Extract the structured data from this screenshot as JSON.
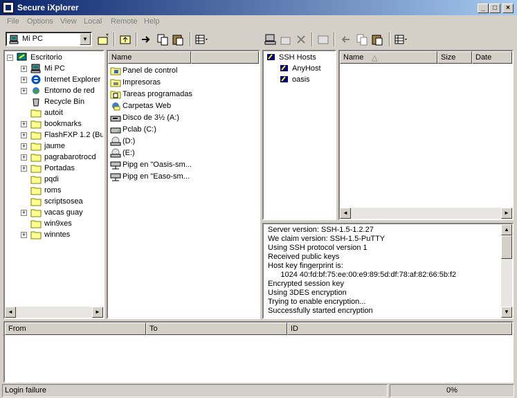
{
  "window": {
    "title": "Secure iXplorer",
    "controls": [
      "_",
      "□",
      "×"
    ]
  },
  "menu": [
    "File",
    "Options",
    "View",
    "Local",
    "Remote",
    "Help"
  ],
  "local": {
    "location": "Mi PC",
    "tree": [
      {
        "label": "Escritorio",
        "icon": "desktop-icon",
        "expander": "−"
      },
      {
        "label": "Mi PC",
        "icon": "computer-icon",
        "expander": "+"
      },
      {
        "label": "Internet Explorer",
        "icon": "ie-icon",
        "expander": "+"
      },
      {
        "label": "Entorno de red",
        "icon": "network-icon",
        "expander": "+"
      },
      {
        "label": "Recycle Bin",
        "icon": "recycle-bin-icon",
        "expander": ""
      },
      {
        "label": "autoit",
        "icon": "folder-icon",
        "expander": ""
      },
      {
        "label": "bookmarks",
        "icon": "folder-icon",
        "expander": "+"
      },
      {
        "label": "FlashFXP 1.2 (Bu",
        "icon": "folder-icon",
        "expander": "+"
      },
      {
        "label": "jaume",
        "icon": "folder-icon",
        "expander": "+"
      },
      {
        "label": "pagrabarotrocd",
        "icon": "folder-icon",
        "expander": "+"
      },
      {
        "label": "Portadas",
        "icon": "folder-icon",
        "expander": "+"
      },
      {
        "label": "pqdi",
        "icon": "folder-icon",
        "expander": ""
      },
      {
        "label": "roms",
        "icon": "folder-icon",
        "expander": ""
      },
      {
        "label": "scriptsosea",
        "icon": "folder-icon",
        "expander": ""
      },
      {
        "label": "vacas guay",
        "icon": "folder-icon",
        "expander": "+"
      },
      {
        "label": "win9xes",
        "icon": "folder-icon",
        "expander": ""
      },
      {
        "label": "winntes",
        "icon": "folder-icon",
        "expander": "+"
      }
    ],
    "list_header": "Name",
    "items": [
      {
        "label": "Panel de control",
        "icon": "control-panel-icon"
      },
      {
        "label": "Impresoras",
        "icon": "printers-icon"
      },
      {
        "label": "Tareas programadas",
        "icon": "scheduled-tasks-icon"
      },
      {
        "label": "Carpetas Web",
        "icon": "web-folders-icon"
      },
      {
        "label": "Disco de 3½ (A:)",
        "icon": "floppy-drive-icon"
      },
      {
        "label": "Pclab (C:)",
        "icon": "hard-drive-icon"
      },
      {
        "label": "(D:)",
        "icon": "cd-drive-icon"
      },
      {
        "label": "(E:)",
        "icon": "cd-drive-icon"
      },
      {
        "label": "Pipg en \"Oasis-sm...",
        "icon": "network-drive-icon"
      },
      {
        "label": "Pipg en \"Easo-sm...",
        "icon": "network-drive-icon"
      }
    ]
  },
  "remote": {
    "hosts_title": "SSH Hosts",
    "hosts": [
      "AnyHost",
      "oasis"
    ],
    "columns": [
      "Name",
      "Size",
      "Date"
    ],
    "sort_indicator": "△",
    "log": [
      "Server version: SSH-1.5-1.2.27",
      "We claim version: SSH-1.5-PuTTY",
      "Using SSH protocol version 1",
      "Received public keys",
      "Host key fingerprint is:",
      "      1024 40:fd:bf:75:ee:00:e9:89:5d:df:78:af:82:66:5b:f2",
      "Encrypted session key",
      "Using 3DES encryption",
      "Trying to enable encryption...",
      "Successfully started encryption"
    ]
  },
  "queue": {
    "columns": [
      "From",
      "To",
      "ID"
    ]
  },
  "status": {
    "message": "Login failure",
    "progress": "0%"
  }
}
